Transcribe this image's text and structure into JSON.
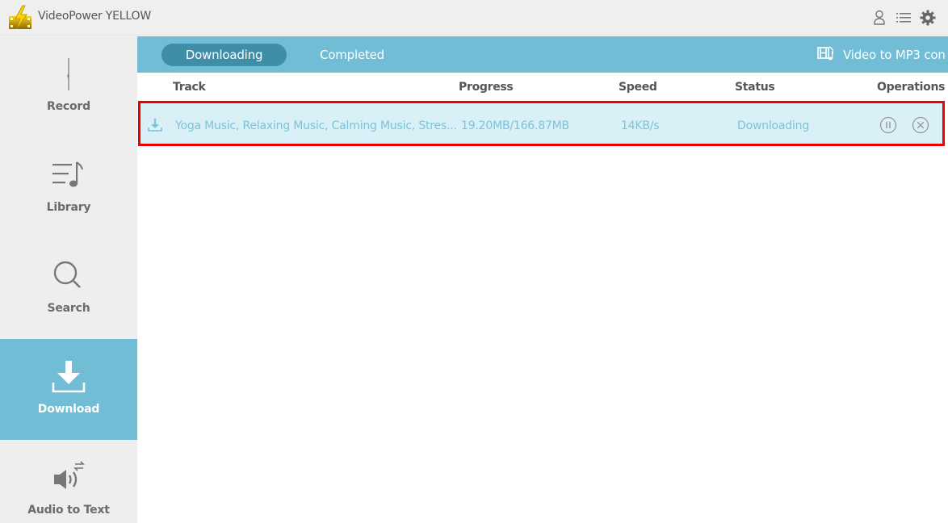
{
  "app": {
    "title": "VideoPower YELLOW",
    "logo_icon": "video-lightning-logo"
  },
  "titlebar_icons": [
    {
      "name": "user-icon"
    },
    {
      "name": "menu-list-icon"
    },
    {
      "name": "gear-icon"
    }
  ],
  "sidebar": {
    "items": [
      {
        "label": "Record",
        "icon": "record-icon",
        "active": false
      },
      {
        "label": "Library",
        "icon": "music-list-icon",
        "active": false
      },
      {
        "label": "Search",
        "icon": "search-icon",
        "active": false
      },
      {
        "label": "Download",
        "icon": "download-icon",
        "active": true
      },
      {
        "label": "Audio to Text",
        "icon": "audio-to-text-icon",
        "active": false
      }
    ]
  },
  "tabs": [
    {
      "label": "Downloading",
      "active": true
    },
    {
      "label": "Completed",
      "active": false
    }
  ],
  "converter": {
    "label": "Video to MP3 con",
    "icon": "video-to-mp3-icon"
  },
  "table": {
    "columns": [
      "Track",
      "Progress",
      "Speed",
      "Status",
      "Operations"
    ],
    "rows": [
      {
        "track": "Yoga Music, Relaxing Music, Calming Music, Stres...",
        "progress": "19.20MB/166.87MB",
        "speed": "14KB/s",
        "status": "Downloading",
        "operations": [
          "pause",
          "cancel"
        ]
      }
    ]
  },
  "colors": {
    "accent": "#70bdd5",
    "tab_active": "#3f8ea8",
    "row_bg": "#d9f0f7",
    "row_text": "#7cc3d9",
    "highlight": "#ee0000",
    "sidebar_bg": "#eeeeee"
  }
}
